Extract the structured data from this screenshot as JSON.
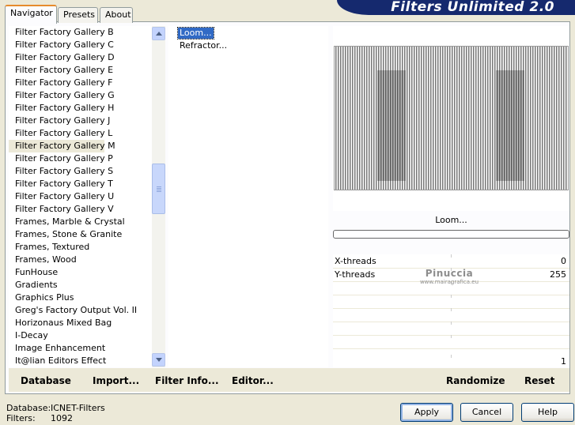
{
  "app": {
    "title": "Filters Unlimited 2.0"
  },
  "tabs": [
    {
      "label": "Navigator",
      "active": true
    },
    {
      "label": "Presets",
      "active": false
    },
    {
      "label": "About",
      "active": false
    }
  ],
  "categories": {
    "selected": "Filter Factory Gallery M",
    "items": [
      "Filter Factory Gallery B",
      "Filter Factory Gallery C",
      "Filter Factory Gallery D",
      "Filter Factory Gallery E",
      "Filter Factory Gallery F",
      "Filter Factory Gallery G",
      "Filter Factory Gallery H",
      "Filter Factory Gallery J",
      "Filter Factory Gallery L",
      "Filter Factory Gallery M",
      "Filter Factory Gallery P",
      "Filter Factory Gallery S",
      "Filter Factory Gallery T",
      "Filter Factory Gallery U",
      "Filter Factory Gallery V",
      "Frames, Marble & Crystal",
      "Frames, Stone & Granite",
      "Frames, Textured",
      "Frames, Wood",
      "FunHouse",
      "Gradients",
      "Graphics Plus",
      "Greg's Factory Output Vol. II",
      "Horizonaus Mixed Bag",
      "I-Decay",
      "Image Enhancement",
      "It@lian Editors Effect"
    ]
  },
  "filters": {
    "selected": "Loom...",
    "items": [
      "Loom...",
      "Refractor..."
    ]
  },
  "preview": {
    "filter_name": "Loom...",
    "progress_fraction": 0.0
  },
  "params": [
    {
      "label": "X-threads",
      "value": "0"
    },
    {
      "label": "Y-threads",
      "value": "255"
    },
    {
      "label": "",
      "value": ""
    },
    {
      "label": "",
      "value": ""
    },
    {
      "label": "",
      "value": ""
    },
    {
      "label": "",
      "value": ""
    },
    {
      "label": "",
      "value": ""
    },
    {
      "label": "",
      "value": "1"
    }
  ],
  "watermark": {
    "line1": "Pinuccia",
    "line2": "www.mairagrafica.eu"
  },
  "bottom_links": {
    "database": "Database",
    "import": "Import...",
    "filter_info": "Filter Info...",
    "editor": "Editor...",
    "randomize": "Randomize",
    "reset": "Reset"
  },
  "status": {
    "database_label": "Database:",
    "database_value": "ICNET-Filters",
    "filters_label": "Filters:",
    "filters_value": "1092"
  },
  "buttons": {
    "apply": "Apply",
    "cancel": "Cancel",
    "help": "Help"
  },
  "colors": {
    "banner": "#15296e",
    "selection": "#316ac5",
    "tab_highlight": "#e68b2c"
  }
}
